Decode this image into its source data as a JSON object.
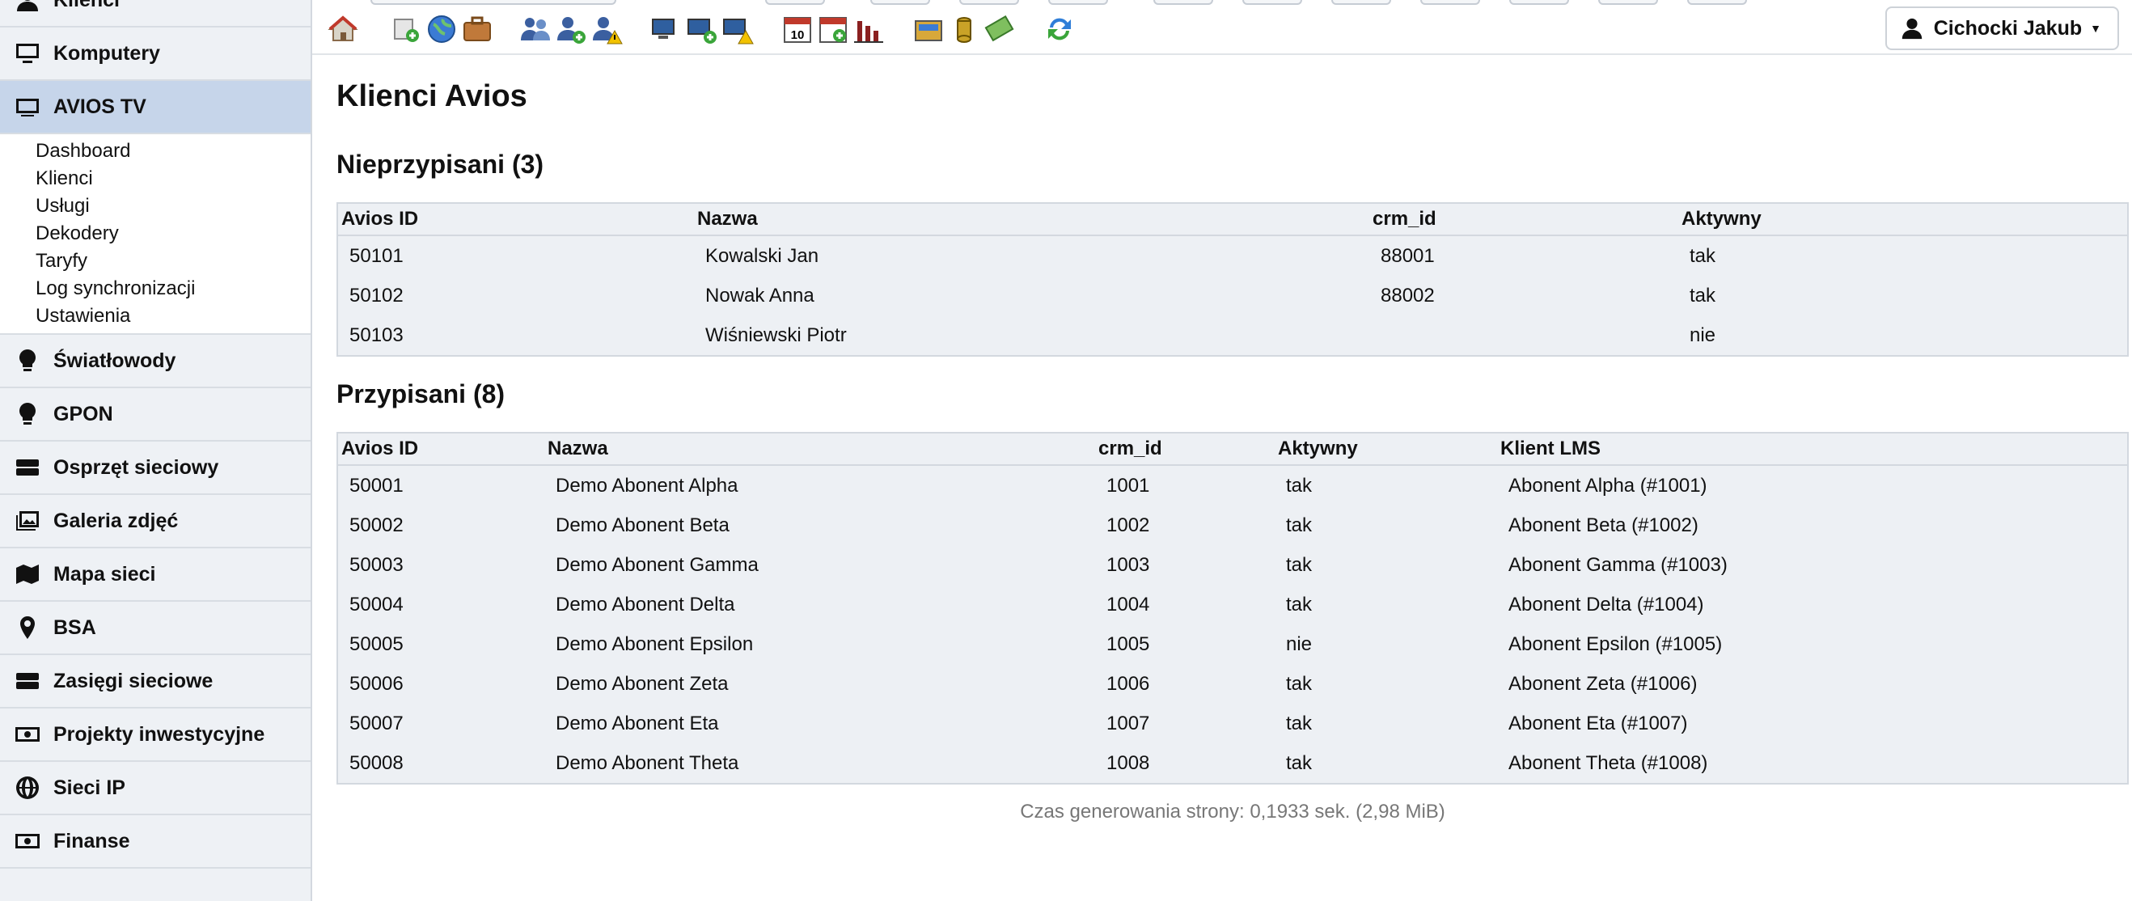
{
  "sidebar": {
    "items_top": [
      {
        "label": "Klienci",
        "icon": "user-icon"
      },
      {
        "label": "Komputery",
        "icon": "monitor-icon"
      },
      {
        "label": "AVIOS TV",
        "icon": "tv-icon"
      }
    ],
    "submenu": [
      "Dashboard",
      "Klienci",
      "Usługi",
      "Dekodery",
      "Taryfy",
      "Log synchronizacji",
      "Ustawienia"
    ],
    "items_bottom": [
      {
        "label": "Światłowody",
        "icon": "lightbulb-icon"
      },
      {
        "label": "GPON",
        "icon": "lightbulb-icon"
      },
      {
        "label": "Osprzęt sieciowy",
        "icon": "server-icon"
      },
      {
        "label": "Galeria zdjęć",
        "icon": "gallery-icon"
      },
      {
        "label": "Mapa sieci",
        "icon": "map-icon"
      },
      {
        "label": "BSA",
        "icon": "map-pin-icon"
      },
      {
        "label": "Zasięgi sieciowe",
        "icon": "server-icon"
      },
      {
        "label": "Projekty inwestycyjne",
        "icon": "money-icon"
      },
      {
        "label": "Sieci IP",
        "icon": "globe-icon"
      },
      {
        "label": "Finanse",
        "icon": "money-icon"
      }
    ]
  },
  "toolbar": {
    "icons": [
      "home-icon",
      "new-document-icon",
      "globe-icon",
      "briefcase-icon",
      "users-icon",
      "add-user-icon",
      "user-warning-icon",
      "computers-icon",
      "add-computer-icon",
      "computer-warning-icon",
      "calendar-icon",
      "add-calendar-icon",
      "bar-chart-icon",
      "cash-register-icon",
      "coins-icon",
      "money-icon",
      "sync-icon"
    ]
  },
  "user": {
    "name": "Cichocki Jakub"
  },
  "page": {
    "title": "Klienci Avios"
  },
  "unassigned": {
    "heading": "Nieprzypisani (3)",
    "columns": [
      "Avios ID",
      "Nazwa",
      "crm_id",
      "Aktywny"
    ],
    "rows": [
      [
        "50101",
        "Kowalski Jan",
        "88001",
        "tak"
      ],
      [
        "50102",
        "Nowak Anna",
        "88002",
        "tak"
      ],
      [
        "50103",
        "Wiśniewski Piotr",
        "",
        "nie"
      ]
    ]
  },
  "assigned": {
    "heading": "Przypisani (8)",
    "columns": [
      "Avios ID",
      "Nazwa",
      "crm_id",
      "Aktywny",
      "Klient LMS"
    ],
    "rows": [
      [
        "50001",
        "Demo Abonent Alpha",
        "1001",
        "tak",
        "Abonent Alpha (#1001)"
      ],
      [
        "50002",
        "Demo Abonent Beta",
        "1002",
        "tak",
        "Abonent Beta (#1002)"
      ],
      [
        "50003",
        "Demo Abonent Gamma",
        "1003",
        "tak",
        "Abonent Gamma (#1003)"
      ],
      [
        "50004",
        "Demo Abonent Delta",
        "1004",
        "tak",
        "Abonent Delta (#1004)"
      ],
      [
        "50005",
        "Demo Abonent Epsilon",
        "1005",
        "nie",
        "Abonent Epsilon (#1005)"
      ],
      [
        "50006",
        "Demo Abonent Zeta",
        "1006",
        "tak",
        "Abonent Zeta (#1006)"
      ],
      [
        "50007",
        "Demo Abonent Eta",
        "1007",
        "tak",
        "Abonent Eta (#1007)"
      ],
      [
        "50008",
        "Demo Abonent Theta",
        "1008",
        "tak",
        "Abonent Theta (#1008)"
      ]
    ]
  },
  "footer": {
    "text": "Czas generowania strony: 0,1933 sek. (2,98 MiB)"
  }
}
